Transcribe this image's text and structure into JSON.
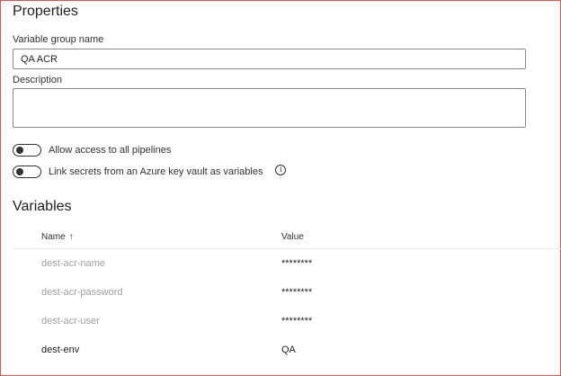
{
  "properties": {
    "title": "Properties",
    "variable_group_name_label": "Variable group name",
    "variable_group_name_value": "QA ACR",
    "description_label": "Description",
    "description_value": "",
    "toggles": [
      {
        "label": "Allow access to all pipelines",
        "state": "off"
      },
      {
        "label": "Link secrets from an Azure key vault as variables",
        "state": "off"
      }
    ]
  },
  "variables": {
    "title": "Variables",
    "columns": {
      "name": "Name",
      "sort_icon": "arrow-up-icon",
      "value": "Value"
    },
    "rows": [
      {
        "name": "dest-acr-name",
        "value": "********"
      },
      {
        "name": "dest-acr-password",
        "value": "********"
      },
      {
        "name": "dest-acr-user",
        "value": "********"
      },
      {
        "name": "dest-env",
        "value": "QA"
      }
    ]
  },
  "colors": {
    "frame_border": "#d9534f",
    "muted_text": "#a19f9d",
    "text": "#201f1e"
  }
}
